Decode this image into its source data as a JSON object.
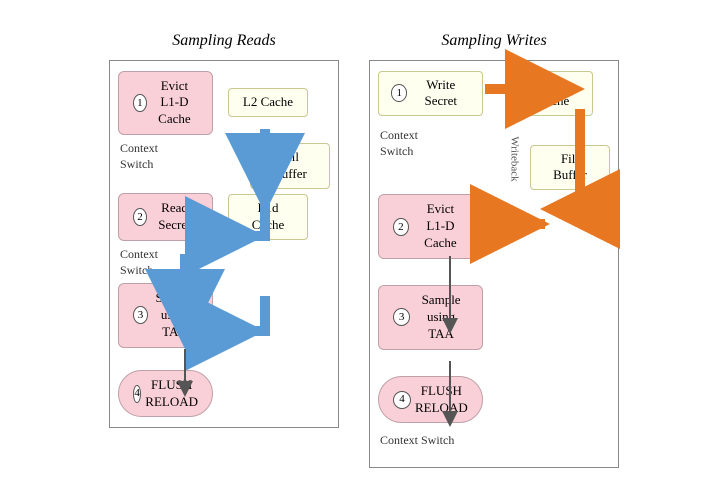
{
  "left_diagram": {
    "title": "Sampling Reads",
    "step1": {
      "num": "1",
      "line1": "Evict",
      "line2": "L1-D Cache"
    },
    "step2": {
      "num": "2",
      "line1": "Read Secret"
    },
    "step3": {
      "num": "3",
      "line1": "Sample",
      "line2": "using TAA"
    },
    "step4": {
      "num": "4",
      "line1": "FLUSH",
      "line2": "RELOAD"
    },
    "l2cache": "L2 Cache",
    "fillbuffer": "Fill Buffer",
    "l1dcache": "L1d Cache",
    "ctx1": "Context\nSwitch",
    "ctx2": "Context\nSwitch"
  },
  "right_diagram": {
    "title": "Sampling Writes",
    "step1": {
      "num": "1",
      "line1": "Write Secret"
    },
    "step2": {
      "num": "2",
      "line1": "Evict",
      "line2": "L1-D Cache"
    },
    "step3": {
      "num": "3",
      "line1": "Sample",
      "line2": "using TAA"
    },
    "step4": {
      "num": "4",
      "line1": "FLUSH",
      "line2": "RELOAD"
    },
    "l1dcache": "L1-D Cache",
    "fillbuffer": "Fill Buffer",
    "writeback": "Writeback",
    "ctx1": "Context\nSwitch",
    "ctx2": "Context\nSwitch"
  }
}
